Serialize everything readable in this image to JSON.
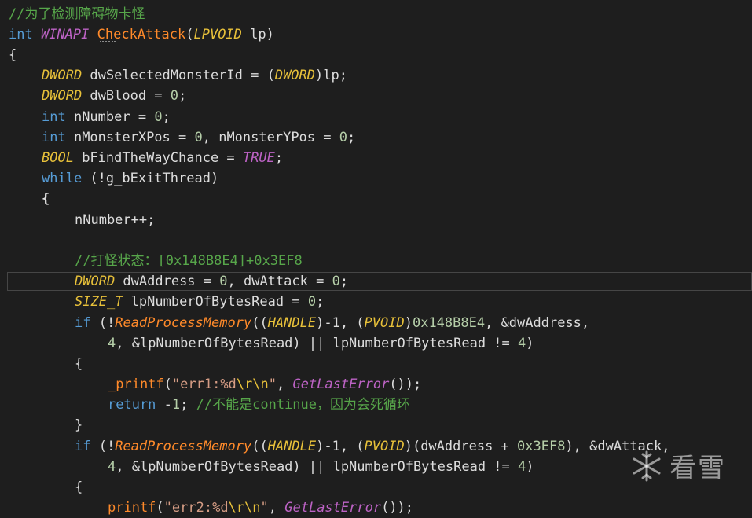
{
  "code": {
    "l1_comment": "//为了检测障碍物卡怪",
    "l2": {
      "type": "int",
      "conv": "WINAPI",
      "name": "CheckAttack",
      "paren_open": "(",
      "ptype": "LPVOID",
      "pname": " lp)"
    },
    "l3": "{",
    "l4": {
      "type": "DWORD",
      "rest1": " dwSelectedMonsterId = (",
      "cast": "DWORD",
      "rest2": ")lp;"
    },
    "l5": {
      "type": "DWORD",
      "rest1": " dwBlood = ",
      "num": "0",
      "rest2": ";"
    },
    "l6": {
      "type": "int",
      "rest1": " nNumber = ",
      "num": "0",
      "rest2": ";"
    },
    "l7": {
      "type": "int",
      "rest1": " nMonsterXPos = ",
      "num1": "0",
      "rest2": ", nMonsterYPos = ",
      "num2": "0",
      "rest3": ";"
    },
    "l8": {
      "type": "BOOL",
      "rest1": " bFindTheWayChance = ",
      "macro": "TRUE",
      "rest2": ";"
    },
    "l9": {
      "kw": "while",
      "rest": " (!g_bExitThread)"
    },
    "l10": "{",
    "l11": "nNumber++;",
    "l12_comment": "//打怪状态：[0x148B8E4]+0x3EF8",
    "l13": {
      "type": "DWORD",
      "rest1": " dwAddress = ",
      "num1": "0",
      "rest2": ", dwAttack = ",
      "num2": "0",
      "rest3": ";"
    },
    "l14": {
      "type": "SIZE_T",
      "rest1": " lpNumberOfBytesRead = ",
      "num": "0",
      "rest2": ";"
    },
    "l15": {
      "kw": "if",
      "p1": " (!",
      "fn": "ReadProcessMemory",
      "p2": "((",
      "cast1": "HANDLE",
      "p3": ")-1, (",
      "cast2": "PVOID",
      "p4": ")",
      "num": "0x148B8E4",
      "p5": ", &dwAddress,"
    },
    "l16": {
      "num": "4",
      "rest1": ", &lpNumberOfBytesRead) || lpNumberOfBytesRead != ",
      "num2": "4",
      "rest2": ")"
    },
    "l17": "{",
    "l18": {
      "fn": "_printf",
      "p1": "(",
      "str1": "\"err1:%d",
      "esc": "\\r\\n",
      "str2": "\"",
      "p2": ", ",
      "fn2": "GetLastError",
      "p3": "());"
    },
    "l19": {
      "kw": "return",
      "rest1": " -",
      "num": "1",
      "rest2": "; ",
      "comment": "//不能是continue，因为会死循环"
    },
    "l20": "}",
    "l21": {
      "kw": "if",
      "p1": " (!",
      "fn": "ReadProcessMemory",
      "p2": "((",
      "cast1": "HANDLE",
      "p3": ")-1, (",
      "cast2": "PVOID",
      "p4": ")(dwAddress + ",
      "num": "0x3EF8",
      "p5": "), &dwAttack,"
    },
    "l22": {
      "num": "4",
      "rest1": ", &lpNumberOfBytesRead) || lpNumberOfBytesRead != ",
      "num2": "4",
      "rest2": ")"
    },
    "l23": "{",
    "l24": {
      "fn": "printf",
      "p1": "(",
      "str1": "\"err2:%d",
      "esc": "\\r\\n",
      "str2": "\"",
      "p2": ", ",
      "fn2": "GetLastError",
      "p3": "());"
    }
  },
  "watermark": {
    "text": "看雪",
    "icon": "snowflake-icon"
  }
}
